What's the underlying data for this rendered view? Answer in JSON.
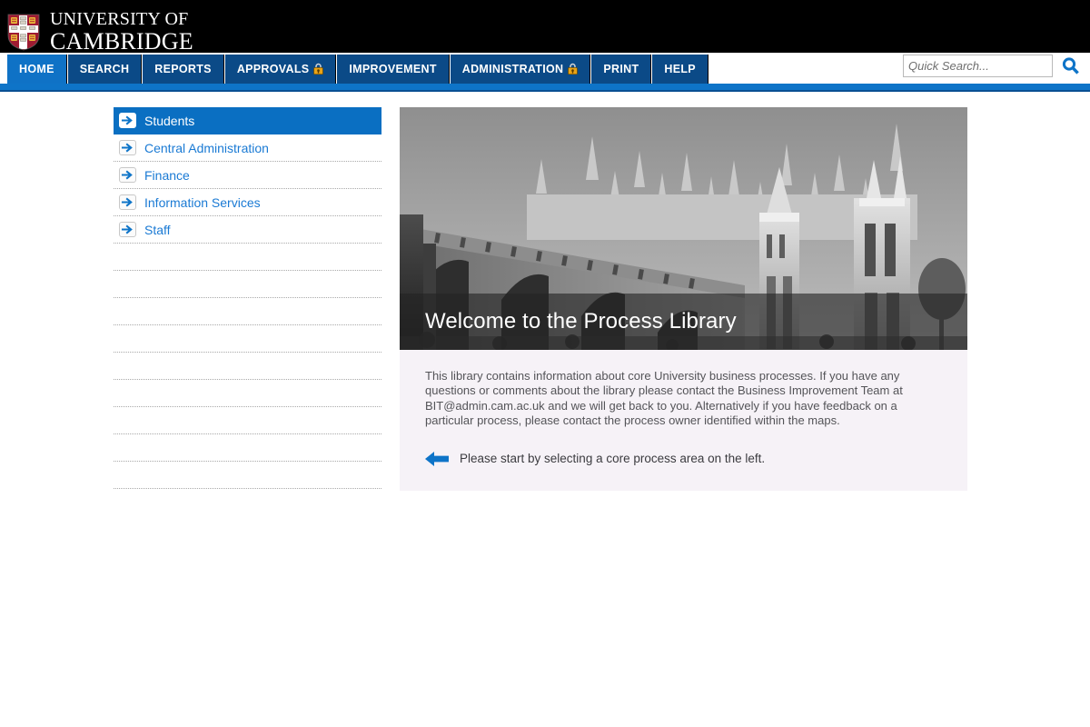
{
  "header": {
    "brand_line1": "UNIVERSITY OF",
    "brand_line2": "CAMBRIDGE",
    "crest_icon": "cambridge-crest-icon",
    "background_color": "#000000"
  },
  "search": {
    "placeholder": "Quick Search...",
    "value": "",
    "button_icon": "search-icon",
    "icon_color": "#0e74c8"
  },
  "nav": {
    "active": "HOME",
    "active_color": "#0f72c6",
    "inactive_color": "#0b4a87",
    "items": [
      {
        "label": "HOME",
        "locked": false,
        "active": true
      },
      {
        "label": "SEARCH",
        "locked": false,
        "active": false
      },
      {
        "label": "REPORTS",
        "locked": false,
        "active": false
      },
      {
        "label": "APPROVALS",
        "locked": true,
        "active": false
      },
      {
        "label": "IMPROVEMENT",
        "locked": false,
        "active": false
      },
      {
        "label": "ADMINISTRATION",
        "locked": true,
        "active": false
      },
      {
        "label": "PRINT",
        "locked": false,
        "active": false
      },
      {
        "label": "HELP",
        "locked": false,
        "active": false
      }
    ],
    "lock_icon": "lock-icon",
    "lock_color": "#e8a317"
  },
  "sidebar": {
    "items": [
      {
        "label": "Students",
        "active": true
      },
      {
        "label": "Central Administration",
        "active": false
      },
      {
        "label": "Finance",
        "active": false
      },
      {
        "label": "Information Services",
        "active": false
      },
      {
        "label": "Staff",
        "active": false
      }
    ],
    "blank_rows": 9,
    "arrow_icon": "arrow-right-icon",
    "link_color": "#1a7ad4",
    "active_background": "#0a6fc2"
  },
  "main": {
    "banner": {
      "title": "Welcome to the Process Library",
      "image_alt": "kings-college-chapel-photo"
    },
    "intro_text": "This library contains information about core University business processes. If you have any questions or comments about the library please contact the Business Improvement Team at BIT@admin.cam.ac.uk and we will get back to you. Alternatively if you have feedback on a particular process, please contact the process owner identified within the maps.",
    "cta_text": "Please start by selecting a core process area on the left.",
    "cta_icon": "arrow-left-icon",
    "cta_icon_color": "#0e74c8",
    "panel_background": "#f6f2f7"
  }
}
